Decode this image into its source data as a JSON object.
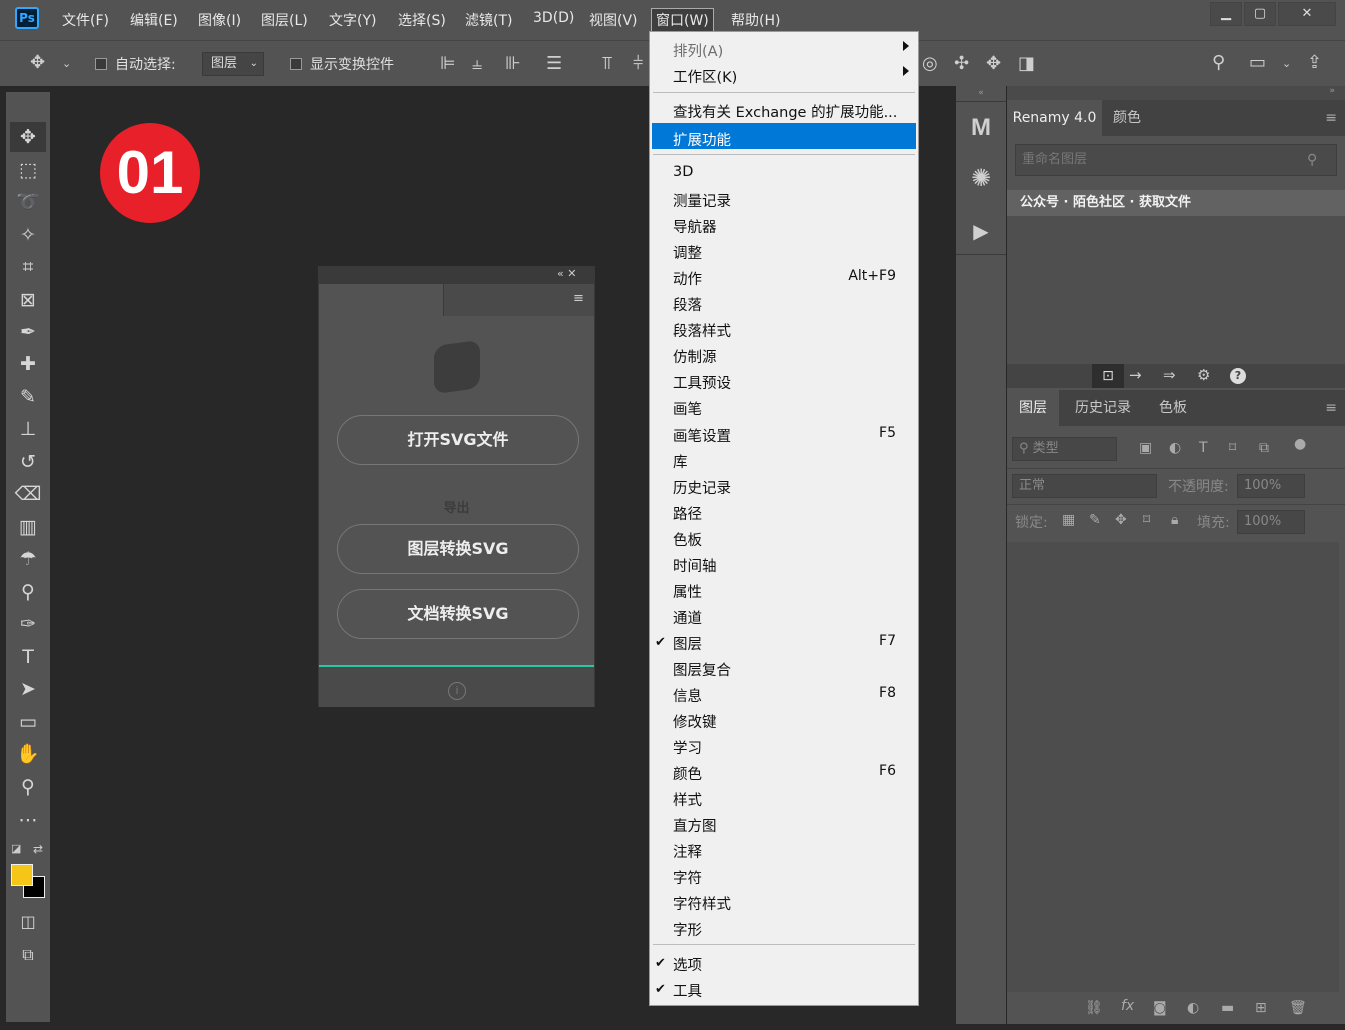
{
  "menubar": {
    "items": [
      "文件(F)",
      "编辑(E)",
      "图像(I)",
      "图层(L)",
      "文字(Y)",
      "选择(S)",
      "滤镜(T)",
      "3D(D)",
      "视图(V)",
      "窗口(W)",
      "帮助(H)"
    ],
    "logo": "Ps",
    "win_min": "▁",
    "win_max": "▢",
    "win_close": "✕"
  },
  "options": {
    "auto_select_label": "自动选择:",
    "auto_select_value": "图层",
    "transform_label": "显示变换控件"
  },
  "badge": "01",
  "plugin": {
    "open_btn": "打开SVG文件",
    "export_label": "导出",
    "layer_btn": "图层转换SVG",
    "doc_btn": "文档转换SVG",
    "info_icon": "i",
    "header_icons": "«  ✕"
  },
  "window_menu": {
    "arrange": "排列(A)",
    "workspace": "工作区(K)",
    "find_ext": "查找有关 Exchange 的扩展功能...",
    "extensions": "扩展功能",
    "items": [
      {
        "label": "3D",
        "shortcut": "",
        "checked": false
      },
      {
        "label": "测量记录",
        "shortcut": "",
        "checked": false
      },
      {
        "label": "导航器",
        "shortcut": "",
        "checked": false
      },
      {
        "label": "调整",
        "shortcut": "",
        "checked": false
      },
      {
        "label": "动作",
        "shortcut": "Alt+F9",
        "checked": false
      },
      {
        "label": "段落",
        "shortcut": "",
        "checked": false
      },
      {
        "label": "段落样式",
        "shortcut": "",
        "checked": false
      },
      {
        "label": "仿制源",
        "shortcut": "",
        "checked": false
      },
      {
        "label": "工具预设",
        "shortcut": "",
        "checked": false
      },
      {
        "label": "画笔",
        "shortcut": "",
        "checked": false
      },
      {
        "label": "画笔设置",
        "shortcut": "F5",
        "checked": false
      },
      {
        "label": "库",
        "shortcut": "",
        "checked": false
      },
      {
        "label": "历史记录",
        "shortcut": "",
        "checked": false
      },
      {
        "label": "路径",
        "shortcut": "",
        "checked": false
      },
      {
        "label": "色板",
        "shortcut": "",
        "checked": false
      },
      {
        "label": "时间轴",
        "shortcut": "",
        "checked": false
      },
      {
        "label": "属性",
        "shortcut": "",
        "checked": false
      },
      {
        "label": "通道",
        "shortcut": "",
        "checked": false
      },
      {
        "label": "图层",
        "shortcut": "F7",
        "checked": true
      },
      {
        "label": "图层复合",
        "shortcut": "",
        "checked": false
      },
      {
        "label": "信息",
        "shortcut": "F8",
        "checked": false
      },
      {
        "label": "修改键",
        "shortcut": "",
        "checked": false
      },
      {
        "label": "学习",
        "shortcut": "",
        "checked": false
      },
      {
        "label": "颜色",
        "shortcut": "F6",
        "checked": false
      },
      {
        "label": "样式",
        "shortcut": "",
        "checked": false
      },
      {
        "label": "直方图",
        "shortcut": "",
        "checked": false
      },
      {
        "label": "注释",
        "shortcut": "",
        "checked": false
      },
      {
        "label": "字符",
        "shortcut": "",
        "checked": false
      },
      {
        "label": "字符样式",
        "shortcut": "",
        "checked": false
      },
      {
        "label": "字形",
        "shortcut": "",
        "checked": false
      }
    ],
    "bottom": [
      {
        "label": "选项",
        "checked": true
      },
      {
        "label": "工具",
        "checked": true
      }
    ]
  },
  "renamy": {
    "tab1": "Renamy 4.0",
    "tab2": "颜色",
    "search_placeholder": "重命名图层",
    "promo": "公众号 · 陌色社区 · 获取文件"
  },
  "layers": {
    "tab1": "图层",
    "tab2": "历史记录",
    "tab3": "色板",
    "filter": "类型",
    "blend": "正常",
    "opacity_label": "不透明度:",
    "opacity": "100%",
    "lock_label": "锁定:",
    "fill_label": "填充:",
    "fill": "100%"
  },
  "colors": {
    "fg": "#f5c518",
    "bg": "#000000",
    "highlight": "#0078d7",
    "badge": "#e8202a",
    "accent_line": "#2ec4a6"
  }
}
